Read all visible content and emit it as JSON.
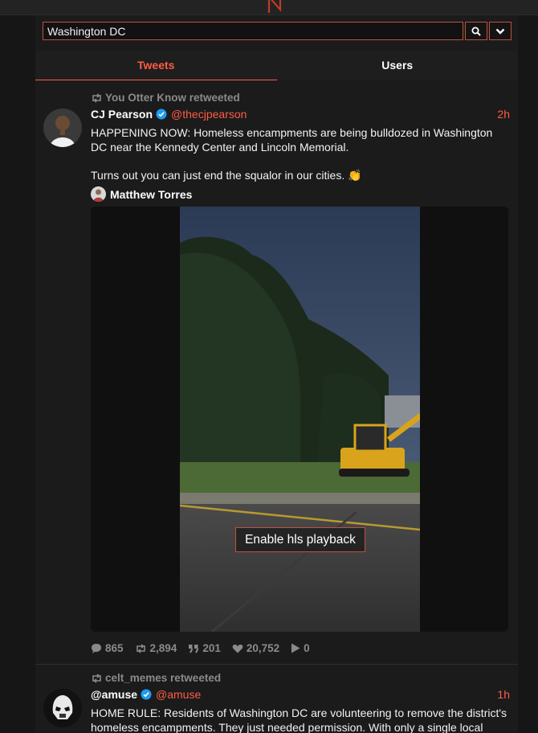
{
  "search": {
    "value": "Washington DC",
    "placeholder": ""
  },
  "tabs": [
    {
      "label": "Tweets",
      "active": true
    },
    {
      "label": "Users",
      "active": false
    }
  ],
  "tweets": [
    {
      "retweeted_by": "You Otter Know retweeted",
      "name": "CJ Pearson",
      "handle": "@thecjpearson",
      "time": "2h",
      "text_1": "HAPPENING NOW: Homeless encampments are being bulldozed in Washington DC near the Kennedy Center and Lincoln Memorial.",
      "text_2": "Turns out you can just end the squalor in our cities. 👏",
      "quote_author": "Matthew Torres",
      "media_button": "Enable hls playback",
      "stats": {
        "replies": "865",
        "retweets": "2,894",
        "quotes": "201",
        "likes": "20,752",
        "views": "0"
      }
    },
    {
      "retweeted_by": "celt_memes retweeted",
      "name": "@amuse",
      "handle": "@amuse",
      "time": "1h",
      "text_1": "HOME RULE: Residents of Washington DC are volunteering to remove the district's homeless encampments. They just needed permission. With only a single local"
    }
  ],
  "colors": {
    "accent": "#ff5c45",
    "background": "#161616",
    "card": "#1b1b1b",
    "muted": "#8a8a8a",
    "verified": "#1d9bf0"
  },
  "icons": [
    "logo-icon",
    "search-icon",
    "chevron-down-icon",
    "retweet-icon",
    "verified-icon",
    "reply-icon",
    "quote-icon",
    "heart-icon",
    "play-icon"
  ]
}
